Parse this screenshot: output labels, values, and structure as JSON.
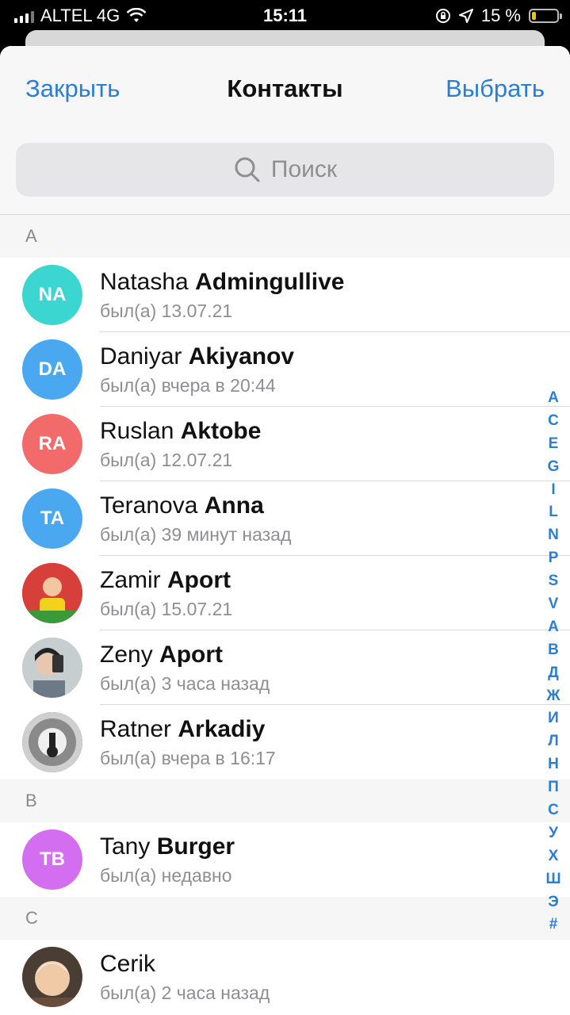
{
  "status_bar": {
    "carrier": "ALTEL 4G",
    "time": "15:11",
    "battery_percent": "15 %",
    "battery_level": 0.15,
    "battery_color": "#f5c400",
    "icons": [
      "signal-icon",
      "wifi-icon",
      "orientation-lock-icon",
      "location-icon",
      "battery-icon"
    ]
  },
  "nav": {
    "close_label": "Закрыть",
    "title": "Контакты",
    "select_label": "Выбрать",
    "accent_color": "#2a7ed4"
  },
  "search": {
    "placeholder": "Поиск",
    "icon": "search-icon"
  },
  "sections": [
    {
      "letter": "A",
      "contacts": [
        {
          "first": "Natasha",
          "last": "Admingullive",
          "status": "был(а) 13.07.21",
          "initials": "NA",
          "avatar_color": "#3cd6d0"
        },
        {
          "first": "Daniyar",
          "last": "Akiyanov",
          "status": "был(а) вчера в 20:44",
          "initials": "DA",
          "avatar_color": "#4aa8f0"
        },
        {
          "first": "Ruslan",
          "last": "Aktobe",
          "status": "был(а) 12.07.21",
          "initials": "RA",
          "avatar_color": "#f36a6a"
        },
        {
          "first": "Teranova",
          "last": "Anna",
          "status": "был(а) 39 минут назад",
          "initials": "TA",
          "avatar_color": "#4aa8f0"
        },
        {
          "first": "Zamir",
          "last": "Aport",
          "status": "был(а) 15.07.21",
          "initials": "",
          "avatar_color": "#c83c32"
        },
        {
          "first": "Zeny",
          "last": "Aport",
          "status": "был(а) 3 часа назад",
          "initials": "",
          "avatar_color": "#b9c2c6"
        },
        {
          "first": "Ratner",
          "last": "Arkadiy",
          "status": "был(а) вчера в 16:17",
          "initials": "",
          "avatar_color": "#5a5a5a"
        }
      ]
    },
    {
      "letter": "B",
      "contacts": [
        {
          "first": "Tany",
          "last": "Burger",
          "status": "был(а) недавно",
          "initials": "TB",
          "avatar_color": "#d36ef0"
        }
      ]
    },
    {
      "letter": "C",
      "contacts": [
        {
          "first": "Cerik",
          "last": "",
          "status": "был(а) 2 часа назад",
          "initials": "",
          "avatar_color": "#c9b89a"
        }
      ]
    }
  ],
  "index_letters": [
    "A",
    "C",
    "E",
    "G",
    "I",
    "L",
    "N",
    "P",
    "S",
    "V",
    "А",
    "В",
    "Д",
    "Ж",
    "И",
    "Л",
    "Н",
    "П",
    "С",
    "У",
    "Х",
    "Ш",
    "Э",
    "#"
  ]
}
